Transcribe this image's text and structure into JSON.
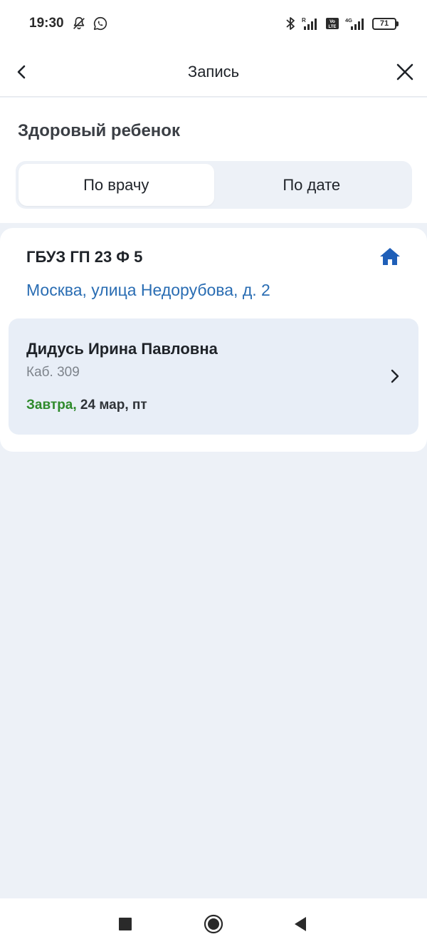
{
  "status_bar": {
    "time": "19:30",
    "battery": "71",
    "icons": [
      "bell-off-icon",
      "whatsapp-icon",
      "bluetooth-icon",
      "signal-icon",
      "volte-icon",
      "signal-4g-icon",
      "battery-icon"
    ]
  },
  "header": {
    "title": "Запись",
    "back_icon": "chevron-left-icon",
    "close_icon": "close-icon"
  },
  "section": {
    "title": "Здоровый ребенок"
  },
  "tabs": [
    {
      "label": "По врачу",
      "active": true
    },
    {
      "label": "По дате",
      "active": false
    }
  ],
  "clinic": {
    "name": "ГБУЗ ГП 23 Ф 5",
    "address": "Москва, улица Недорубова, д. 2",
    "icon": "home-icon"
  },
  "doctor": {
    "name": "Дидусь Ирина Павловна",
    "room": "Каб. 309",
    "date_highlight": "Завтра,",
    "date_rest": " 24 мар, пт"
  },
  "colors": {
    "accent_blue": "#2a6db3",
    "home_icon": "#1f5fb8",
    "green": "#2e8a2b",
    "background": "#edf1f7",
    "doctor_card": "#e8eef7"
  },
  "nav_bar": {
    "icons": [
      "recent-apps-icon",
      "home-button-icon",
      "back-triangle-icon"
    ]
  }
}
